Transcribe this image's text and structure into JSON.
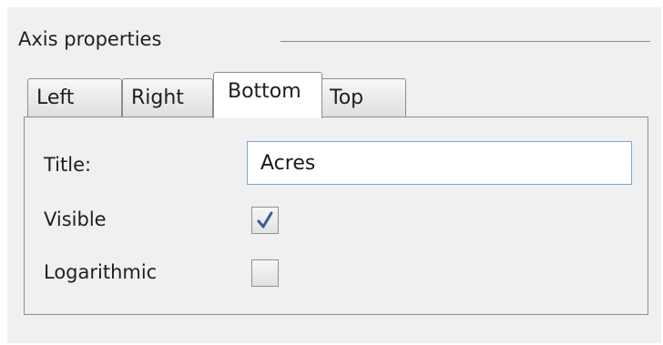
{
  "group": {
    "title": "Axis properties"
  },
  "tabs": [
    {
      "label": "Left",
      "active": false
    },
    {
      "label": "Right",
      "active": false
    },
    {
      "label": "Bottom",
      "active": true
    },
    {
      "label": "Top",
      "active": false
    }
  ],
  "fields": {
    "title": {
      "label": "Title:",
      "value": "Acres"
    },
    "visible": {
      "label": "Visible",
      "checked": true
    },
    "logarithmic": {
      "label": "Logarithmic",
      "checked": false
    }
  },
  "icons": {
    "checkmark": "checkmark-icon"
  },
  "colors": {
    "checkmark": "#3a5a9a",
    "input_border": "#7fa6d1"
  }
}
